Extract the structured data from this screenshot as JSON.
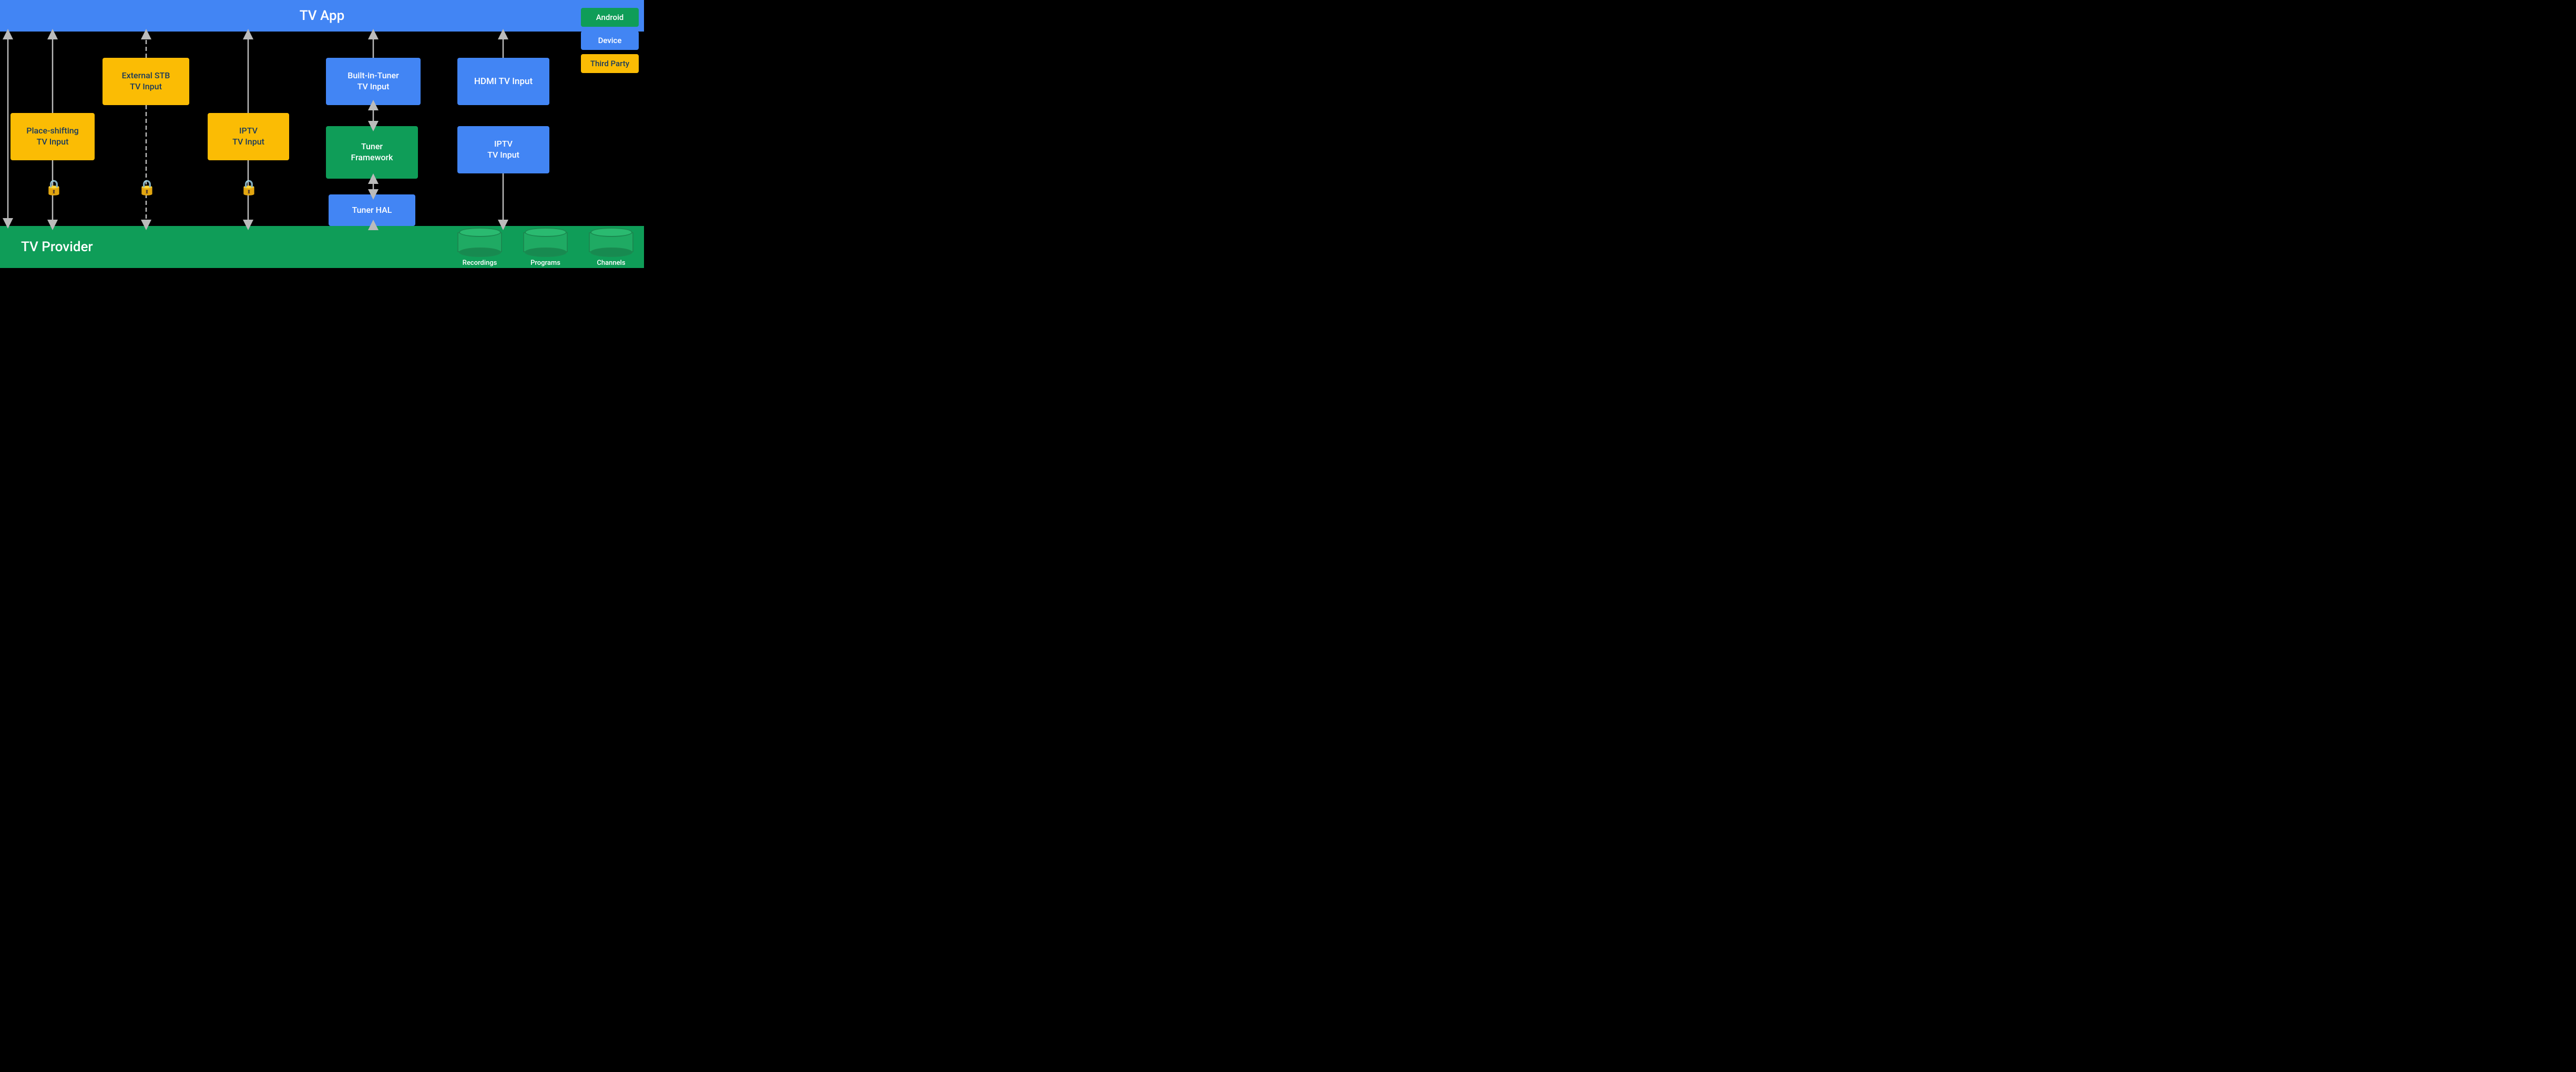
{
  "tvApp": {
    "label": "TV App"
  },
  "tvProvider": {
    "label": "TV Provider"
  },
  "legend": {
    "items": [
      {
        "id": "android",
        "label": "Android",
        "color": "green"
      },
      {
        "id": "device",
        "label": "Device",
        "color": "blue"
      },
      {
        "id": "thirdParty",
        "label": "Third Party",
        "color": "orange"
      }
    ]
  },
  "boxes": {
    "externalSTB": {
      "label": "External STB\nTV Input"
    },
    "placeShifting": {
      "label": "Place-shifting\nTV Input"
    },
    "iptvLeft": {
      "label": "IPTV\nTV Input"
    },
    "builtInTuner": {
      "label": "Built-in-Tuner\nTV Input"
    },
    "tunerFramework": {
      "label": "Tuner\nFramework"
    },
    "tunerHAL": {
      "label": "Tuner HAL"
    },
    "hdmiTVInput": {
      "label": "HDMI TV Input"
    },
    "iptvRight": {
      "label": "IPTV\nTV Input"
    }
  },
  "cylinders": {
    "recordings": {
      "label": "Recordings"
    },
    "programs": {
      "label": "Programs"
    },
    "channels": {
      "label": "Channels"
    }
  }
}
